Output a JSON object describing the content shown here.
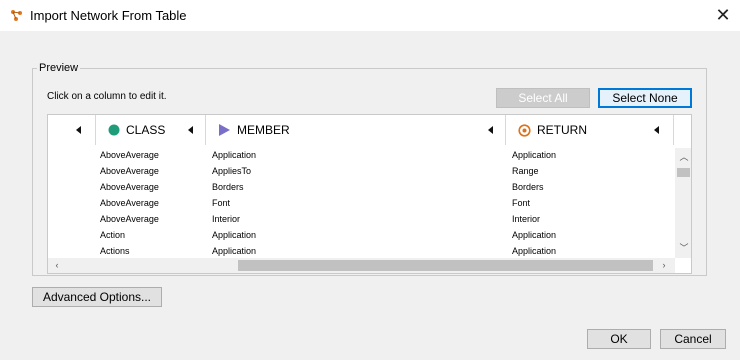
{
  "window": {
    "title": "Import Network From Table",
    "close_glyph": "✕"
  },
  "preview": {
    "group_label": "Preview",
    "hint": "Click on a column to edit it.",
    "select_all_label": "Select All",
    "select_none_label": "Select None"
  },
  "columns": [
    {
      "label": "",
      "icon": "none"
    },
    {
      "label": "CLASS",
      "icon": "green-circle-icon",
      "color": "#1f9d7a"
    },
    {
      "label": "MEMBER",
      "icon": "purple-triangle-icon",
      "color": "#7a6fc8"
    },
    {
      "label": "RETURN",
      "icon": "orange-target-icon",
      "color": "#d9731f"
    }
  ],
  "rows": [
    {
      "class": "AboveAverage",
      "member": "Application",
      "return": "Application"
    },
    {
      "class": "AboveAverage",
      "member": "AppliesTo",
      "return": "Range"
    },
    {
      "class": "AboveAverage",
      "member": "Borders",
      "return": "Borders"
    },
    {
      "class": "AboveAverage",
      "member": "Font",
      "return": "Font"
    },
    {
      "class": "AboveAverage",
      "member": "Interior",
      "return": "Interior"
    },
    {
      "class": "Action",
      "member": "Application",
      "return": "Application"
    },
    {
      "class": "Actions",
      "member": "Application",
      "return": "Application"
    }
  ],
  "footer": {
    "advanced_label": "Advanced Options...",
    "ok_label": "OK",
    "cancel_label": "Cancel"
  }
}
